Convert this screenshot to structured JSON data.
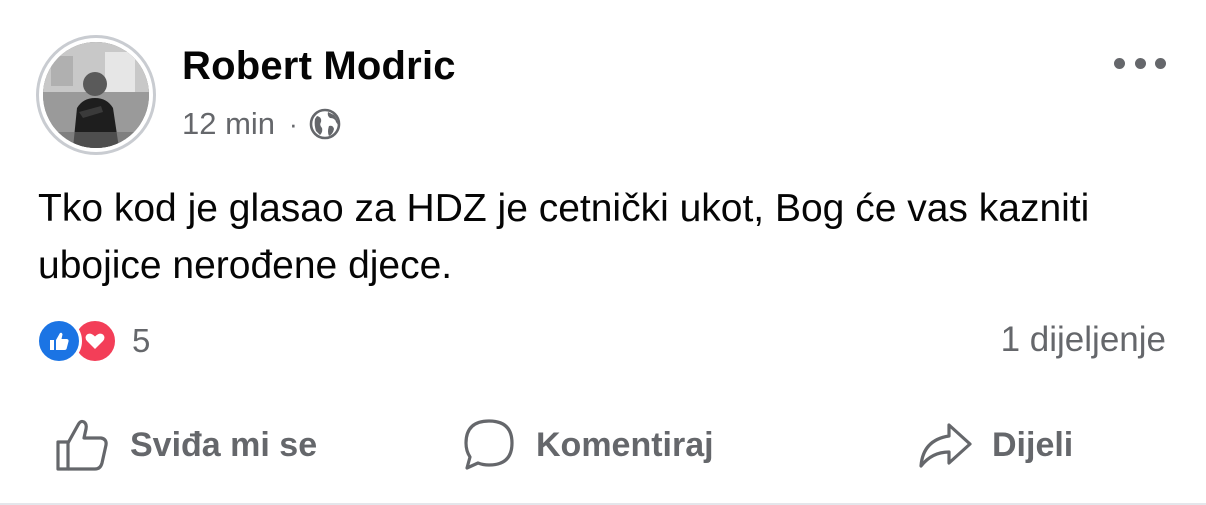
{
  "post": {
    "author": "Robert Modric",
    "time": "12 min",
    "separator": "·",
    "privacy_icon": "globe-icon",
    "more_icon": "more-options-icon",
    "text": "Tko kod je glasao za HDZ je cetnički ukot, Bog će vas kazniti ubojice nerođene djece.",
    "reactions": {
      "types": [
        "like",
        "love"
      ],
      "count": "5",
      "colors": {
        "like": "#1b74e4",
        "love": "#f33e58"
      }
    },
    "shares": "1 dijeljenje"
  },
  "actions": {
    "like_label": "Sviđa mi se",
    "comment_label": "Komentiraj",
    "share_label": "Dijeli"
  },
  "colors": {
    "text": "#050505",
    "secondary": "#65676b",
    "background": "#ffffff"
  }
}
